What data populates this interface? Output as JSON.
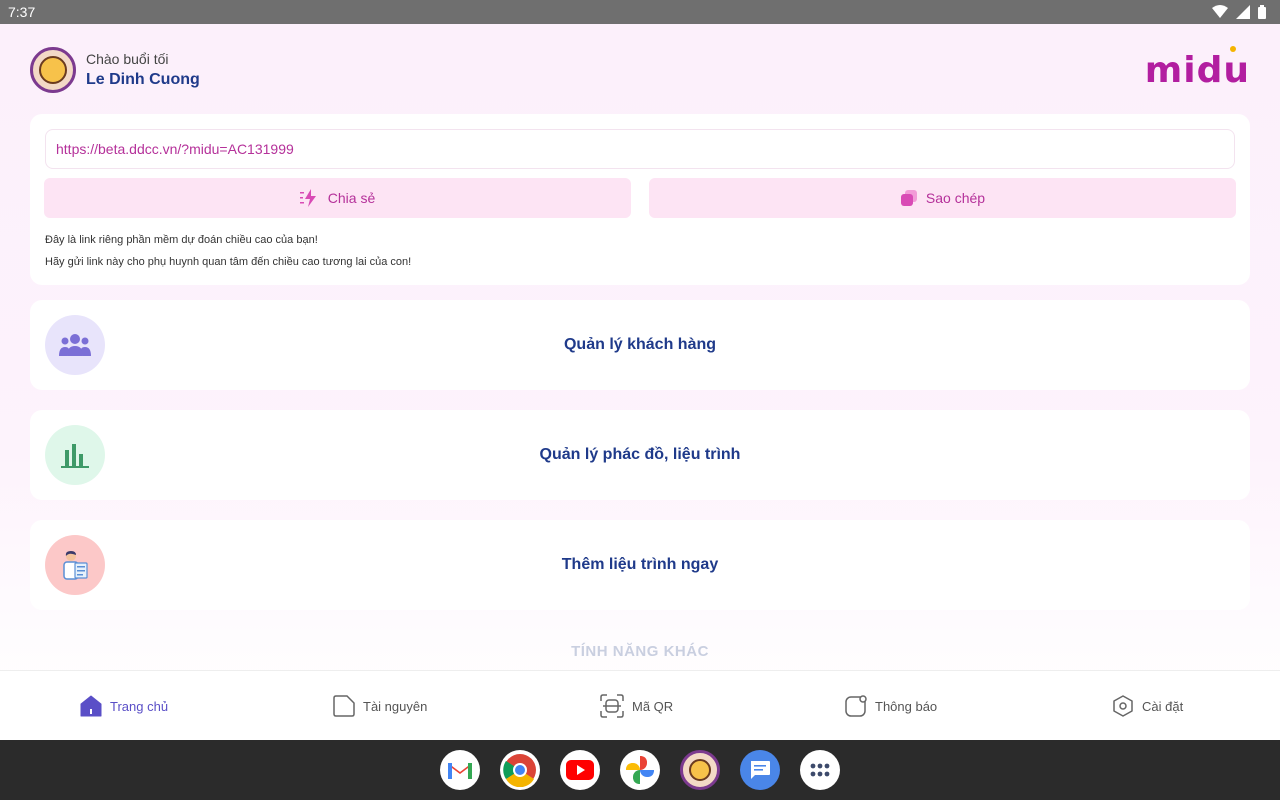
{
  "status_bar": {
    "time": "7:37"
  },
  "header": {
    "greeting": "Chào buổi tối",
    "user_name": "Le Dinh Cuong",
    "logo_text": "midu"
  },
  "link_card": {
    "url": "https://beta.ddcc.vn/?midu=AC131999",
    "share_label": "Chia sẻ",
    "copy_label": "Sao chép",
    "note_line1": "Đây là link riêng phần mềm dự đoán chiều cao của bạn!",
    "note_line2": "Hãy gửi link này cho phụ huynh quan tâm đến chiều cao tương lai của con!"
  },
  "menu": [
    {
      "label": "Quản lý khách hàng",
      "icon": "users-icon",
      "icon_bg": "#e8e4fb",
      "icon_color": "#7b6fd6"
    },
    {
      "label": "Quản lý phác đồ, liệu trình",
      "icon": "bar-chart-icon",
      "icon_bg": "#dff7ea",
      "icon_color": "#3e9a68"
    },
    {
      "label": "Thêm liệu trình ngay",
      "icon": "doctor-icon",
      "icon_bg": "#fcc8c8",
      "icon_color": "#e26b6b"
    }
  ],
  "section_title": "TÍNH NĂNG KHÁC",
  "bottom_nav": [
    {
      "label": "Trang chủ",
      "icon": "home-icon",
      "active": true
    },
    {
      "label": "Tài nguyên",
      "icon": "folder-icon",
      "active": false
    },
    {
      "label": "Mã QR",
      "icon": "qr-scan-icon",
      "active": false
    },
    {
      "label": "Thông báo",
      "icon": "bell-icon",
      "active": false
    },
    {
      "label": "Cài đặt",
      "icon": "settings-icon",
      "active": false
    }
  ],
  "dock": [
    "gmail-icon",
    "chrome-icon",
    "youtube-icon",
    "photos-icon",
    "midu-app-icon",
    "messages-icon",
    "app-drawer-icon"
  ],
  "colors": {
    "accent_pink": "#b5319a",
    "accent_navy": "#1f3a8a",
    "accent_purple": "#5a4fc7"
  }
}
